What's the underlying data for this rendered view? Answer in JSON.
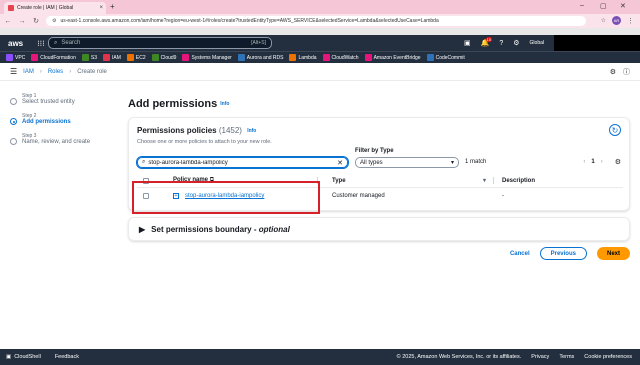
{
  "browser": {
    "tab_title": "Create role | IAM | Global",
    "url": "us-east-1.console.aws.amazon.com/iam/home?region=eu-west-1#/roles/create?trustedEntityType=AWS_SERVICE&selectedService=Lambda&selectedUseCase=Lambda"
  },
  "aws_nav": {
    "logo": "aws",
    "search_placeholder": "Search",
    "search_shortcut": "[Alt+S]",
    "notif_count": "10",
    "region": "Global"
  },
  "favorites": [
    {
      "label": "VPC",
      "color": "#8c4fff"
    },
    {
      "label": "CloudFormation",
      "color": "#e7157b"
    },
    {
      "label": "S3",
      "color": "#3f8624"
    },
    {
      "label": "IAM",
      "color": "#dd344c"
    },
    {
      "label": "EC2",
      "color": "#ed7100"
    },
    {
      "label": "Cloud9",
      "color": "#3f8624"
    },
    {
      "label": "Systems Manager",
      "color": "#e7157b"
    },
    {
      "label": "Aurora and RDS",
      "color": "#2e73b8"
    },
    {
      "label": "Lambda",
      "color": "#ed7100"
    },
    {
      "label": "CloudWatch",
      "color": "#e7157b"
    },
    {
      "label": "Amazon EventBridge",
      "color": "#e7157b"
    },
    {
      "label": "CodeCommit",
      "color": "#2e73b8"
    }
  ],
  "breadcrumb": {
    "iam": "IAM",
    "roles": "Roles",
    "current": "Create role"
  },
  "steps": [
    {
      "num": "Step 1",
      "name": "Select trusted entity"
    },
    {
      "num": "Step 2",
      "name": "Add permissions"
    },
    {
      "num": "Step 3",
      "name": "Name, review, and create"
    }
  ],
  "page": {
    "title": "Add permissions",
    "info": "Info"
  },
  "policies": {
    "title": "Permissions policies",
    "count": "(1452)",
    "info": "Info",
    "desc": "Choose one or more policies to attach to your new role.",
    "search_value": "stop-aurora-lambda-iampolicy",
    "filter_label": "Filter by Type",
    "filter_value": "All types",
    "match": "1 match",
    "page": "1",
    "columns": {
      "name": "Policy name",
      "type": "Type",
      "desc": "Description"
    },
    "rows": [
      {
        "name": "stop-aurora-lambda-iampolicy",
        "type": "Customer managed",
        "desc": "-"
      }
    ]
  },
  "boundary": {
    "label": "Set permissions boundary",
    "opt": "optional",
    "sep": " - "
  },
  "actions": {
    "cancel": "Cancel",
    "previous": "Previous",
    "next": "Next"
  },
  "footer": {
    "cloudshell": "CloudShell",
    "feedback": "Feedback",
    "copyright": "© 2025, Amazon Web Services, Inc. or its affiliates.",
    "privacy": "Privacy",
    "terms": "Terms",
    "cookies": "Cookie preferences"
  }
}
